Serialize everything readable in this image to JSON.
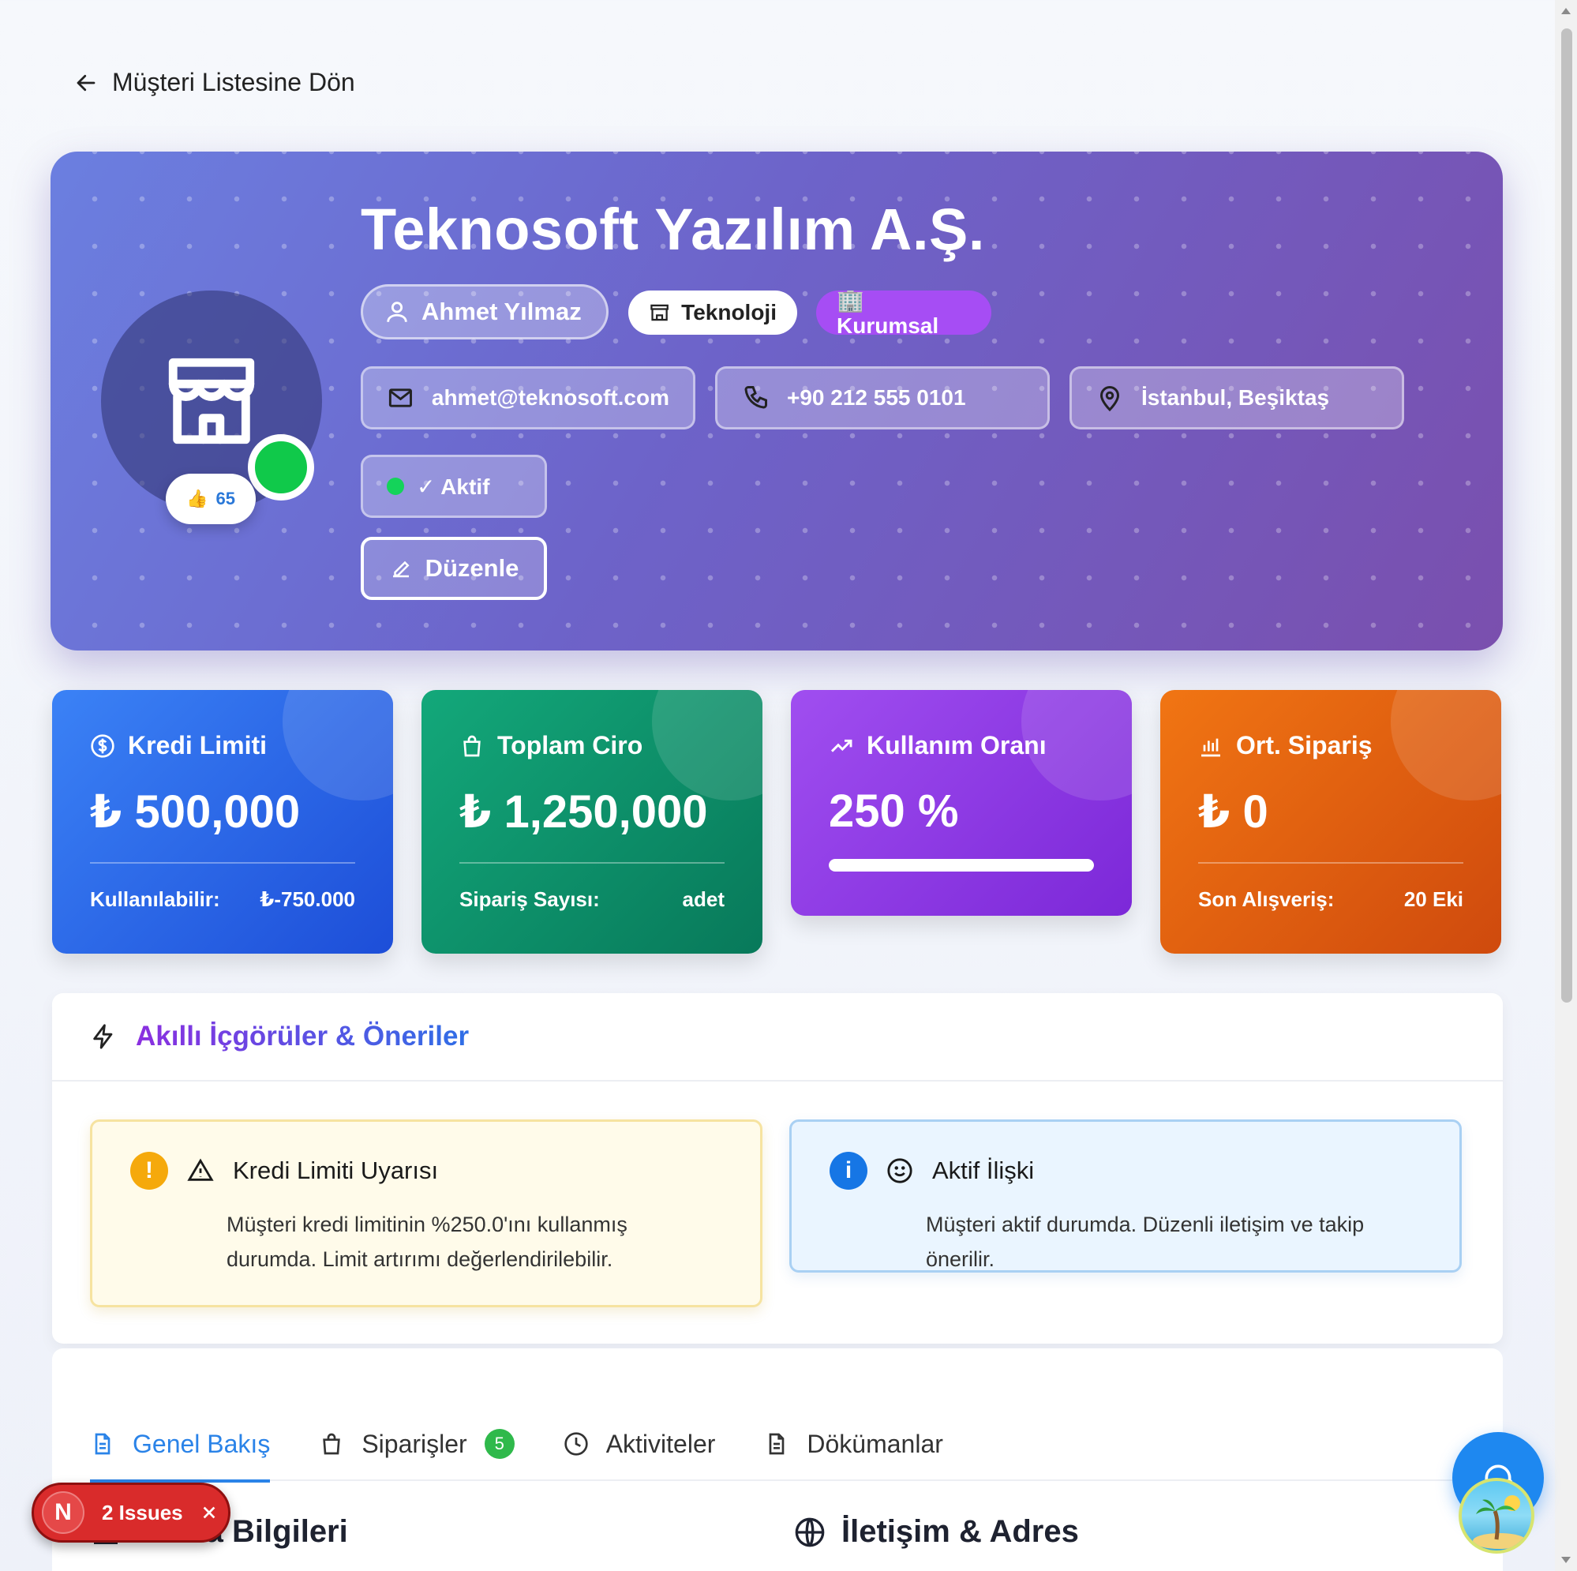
{
  "nav": {
    "back_label": "Müşteri Listesine Dön"
  },
  "customer": {
    "name": "Teknosoft Yazılım A.Ş.",
    "owner": "Ahmet Yılmaz",
    "sector": "Teknoloji",
    "type": "🏢 Kurumsal",
    "email": "ahmet@teknosoft.com",
    "phone": "+90 212 555 0101",
    "location": "İstanbul, Beşiktaş",
    "status": "✓ Aktif",
    "score": "65",
    "edit_label": "Düzenle"
  },
  "stats": [
    {
      "title": "Kredi Limiti",
      "value": "₺ 500,000",
      "foot_label": "Kullanılabilir:",
      "foot_value": "₺-750.000",
      "color": "#2563eb"
    },
    {
      "title": "Toplam Ciro",
      "value": "₺ 1,250,000",
      "foot_label": "Sipariş Sayısı:",
      "foot_value": "adet",
      "color": "#0f8f68"
    },
    {
      "title": "Kullanım Oranı",
      "value": "250 %",
      "progress": 1.0,
      "color": "#8b3be6"
    },
    {
      "title": "Ort. Sipariş",
      "value": "₺ 0",
      "foot_label": "Son Alışveriş:",
      "foot_value": "20 Eki",
      "color": "#e0600f"
    }
  ],
  "insights": {
    "title": "Akıllı İçgörüler & Öneriler",
    "cards": [
      {
        "title": "Kredi Limiti Uyarısı",
        "body": "Müşteri kredi limitinin %250.0'ını kullanmış durumda. Limit artırımı değerlendirilebilir.",
        "badge": "!"
      },
      {
        "title": "Aktif İlişki",
        "body": "Müşteri aktif durumda. Düzenli iletişim ve takip önerilir.",
        "badge": "i"
      }
    ]
  },
  "tabs": [
    {
      "label": "Genel Bakış"
    },
    {
      "label": "Siparişler",
      "count": "5"
    },
    {
      "label": "Aktiviteler"
    },
    {
      "label": "Dökümanlar"
    }
  ],
  "sections": {
    "left": "Firma Bilgileri",
    "right": "İletişim & Adres"
  },
  "devtools": {
    "issues_label": "2 Issues",
    "initial": "N"
  }
}
